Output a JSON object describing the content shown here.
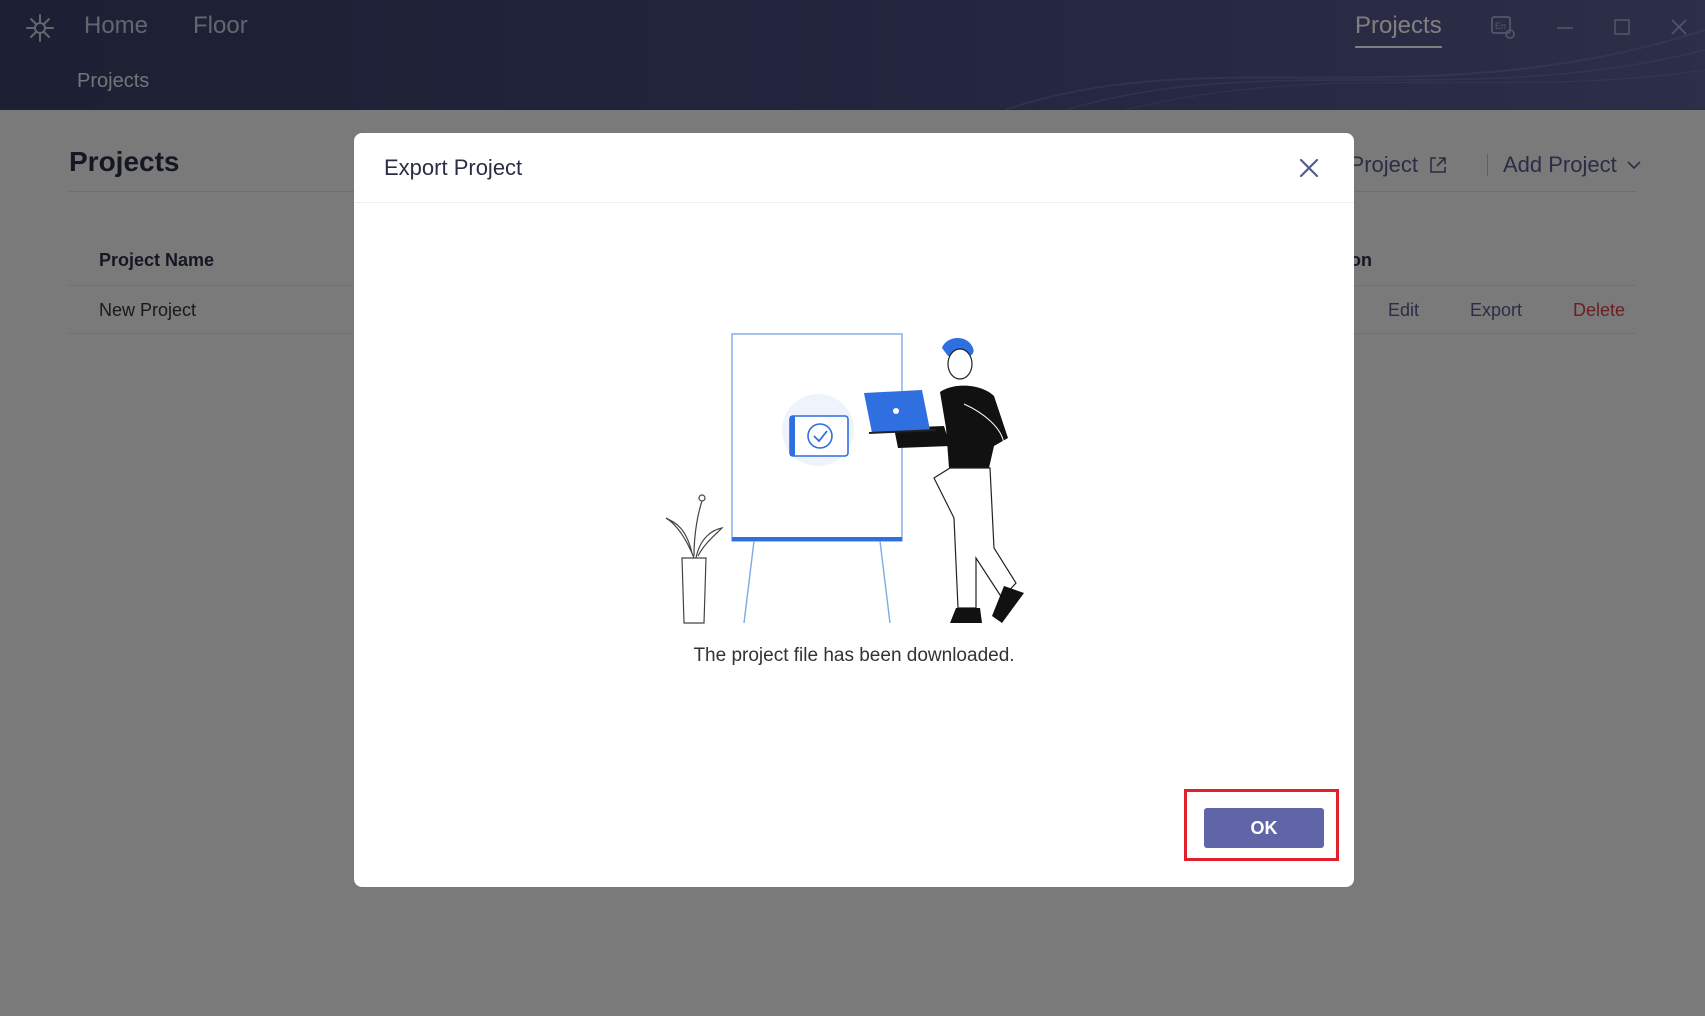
{
  "header": {
    "nav": {
      "home": "Home",
      "floor": "Floor",
      "projects": "Projects"
    },
    "subnav": "Projects",
    "window_icons": [
      "language-icon",
      "minimize-icon",
      "maximize-icon",
      "close-icon"
    ]
  },
  "page": {
    "title": "Projects",
    "toolbar": {
      "import_label": "rt Project",
      "add_label": "Add Project"
    },
    "table": {
      "headers": {
        "name": "Project Name",
        "action": "on"
      },
      "rows": [
        {
          "name": "New Project",
          "actions": {
            "edit": "Edit",
            "export": "Export",
            "delete": "Delete"
          }
        }
      ]
    }
  },
  "modal": {
    "title": "Export Project",
    "message": "The project file has been downloaded.",
    "ok_label": "OK"
  },
  "colors": {
    "header": "#45497a",
    "accent": "#6065a8",
    "delete": "#d94040",
    "highlight": "#e0202a"
  }
}
